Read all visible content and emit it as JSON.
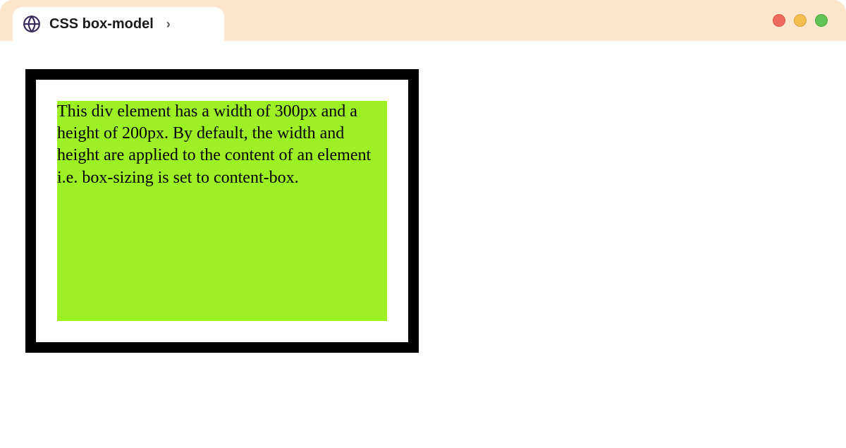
{
  "tab": {
    "title": "CSS box-model"
  },
  "box": {
    "text": "This div element has a width of 300px and a height of 200px. By default, the width and height are applied to the content of an element i.e. box-sizing is set to content-box."
  }
}
